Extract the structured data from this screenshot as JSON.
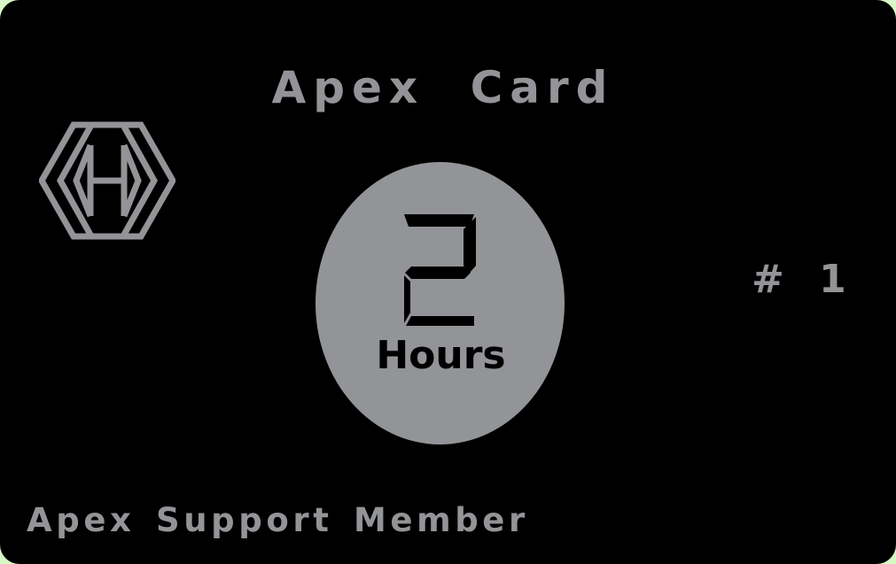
{
  "card": {
    "title": "Apex Card",
    "hours_value": "2",
    "hours_label": "Hours",
    "card_number": "# 1",
    "membership": "Apex Support Member"
  },
  "icons": {
    "logo": "hexagon-monogram-logo",
    "digit": "seven-segment-digit-2"
  },
  "colors": {
    "card_background": "#000000",
    "foreground_gray": "#939497",
    "page_background": "#d9f7c6"
  }
}
